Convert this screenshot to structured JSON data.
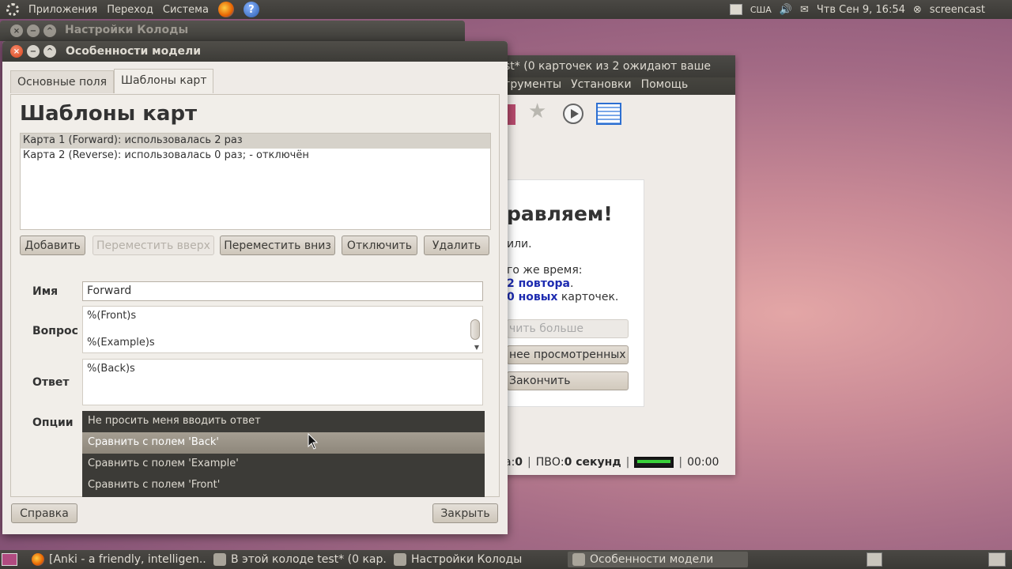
{
  "top_panel": {
    "menu": [
      "Приложения",
      "Переход",
      "Система"
    ],
    "keyboard_layout": "США",
    "datetime": "Чтв Сен  9, 16:54",
    "user": "screencast"
  },
  "anki_window": {
    "title": "st* (0 карточек из 2 ожидают ваше",
    "menu": [
      "грументы",
      "Установки",
      "Помощь"
    ],
    "congrats": "равляем!",
    "text_line1": "или.",
    "text_line2": "го же время:",
    "repeats_num": "2 повтора",
    "new_num": "0 новых",
    "new_suffix": " карточек.",
    "btn_more": "чить больше",
    "btn_recent": "нее просмотренных",
    "btn_finish": "Закончить",
    "status_prefix": "а: ",
    "status_prefix_val": "0",
    "pvo_label": "ПВО: ",
    "pvo_val": "0 секунд",
    "timer": "00:00"
  },
  "deck_window": {
    "title": "Настройки Колоды"
  },
  "dialog": {
    "title": "Особенности модели",
    "tabs": [
      {
        "label": "Основные поля"
      },
      {
        "label": "Шаблоны карт"
      }
    ],
    "heading": "Шаблоны карт",
    "cards": [
      "Карта 1 (Forward): использовалась 2 раз",
      "Карта 2 (Reverse): использовалась 0 раз; - отключён"
    ],
    "buttons": {
      "add": "Добавить",
      "move_up": "Переместить вверх",
      "move_down": "Переместить вниз",
      "disable": "Отключить",
      "delete": "Удалить"
    },
    "labels": {
      "name": "Имя",
      "question": "Вопрос",
      "answer": "Ответ",
      "options": "Опции"
    },
    "name_value": "Forward",
    "question_lines": [
      "%(Front)s",
      "",
      "%(Example)s"
    ],
    "answer_lines": [
      "%(Back)s"
    ],
    "options": [
      "Не просить меня вводить ответ",
      "Сравнить с полем 'Back'",
      "Сравнить с полем 'Example'",
      "Сравнить с полем 'Front'"
    ],
    "help_button": "Справка",
    "close_button": "Закрыть"
  },
  "taskbar": [
    "[Anki - a friendly, intelligen...",
    "В этой колоде test* (0 кар...",
    "Настройки Колоды",
    "Особенности модели"
  ]
}
